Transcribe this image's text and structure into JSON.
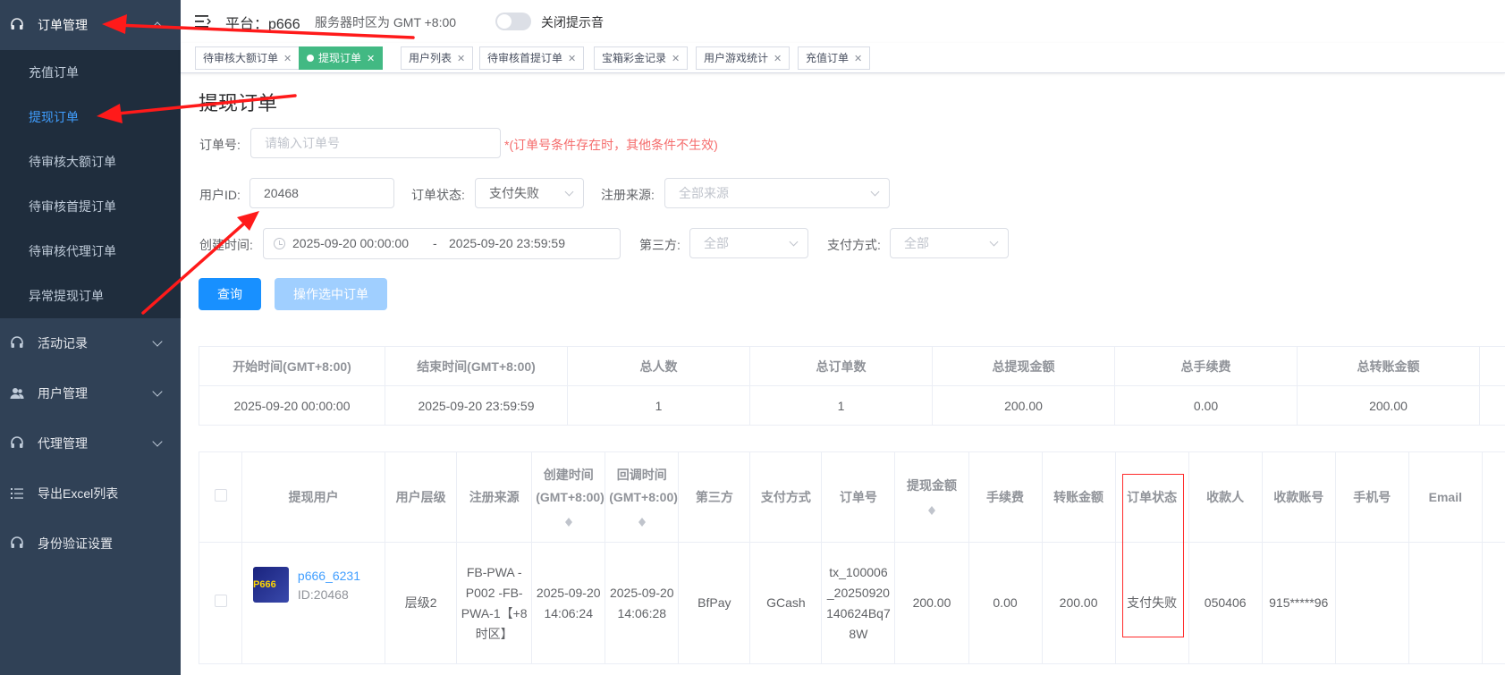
{
  "sidebar": {
    "groups": [
      {
        "label": "订单管理",
        "icon": "headset-icon",
        "expanded": true
      },
      {
        "label": "活动记录",
        "icon": "headset-icon"
      },
      {
        "label": "用户管理",
        "icon": "user-icon"
      },
      {
        "label": "代理管理",
        "icon": "headset-icon"
      },
      {
        "label": "导出Excel列表",
        "icon": "list-icon"
      },
      {
        "label": "身份验证设置",
        "icon": "headset-icon"
      }
    ],
    "order_items": [
      "充值订单",
      "提现订单",
      "待审核大额订单",
      "待审核首提订单",
      "待审核代理订单",
      "异常提现订单"
    ],
    "active_item": "提现订单"
  },
  "navbar": {
    "platform": "平台：p666",
    "timezone": "服务器时区为 GMT +8:00",
    "toggle_label": "关闭提示音",
    "toggle_on": false
  },
  "tags": [
    "待审核大额订单",
    "提现订单",
    "用户列表",
    "待审核首提订单",
    "宝箱彩金记录",
    "用户游戏统计",
    "充值订单"
  ],
  "active_tag": "提现订单",
  "page_title": "提现订单",
  "filters": {
    "order_no_label": "订单号:",
    "order_no_placeholder": "请输入订单号",
    "order_no_hint": "*(订单号条件存在时，其他条件不生效)",
    "user_id_label": "用户ID:",
    "user_id_value": "20468",
    "status_label": "订单状态:",
    "status_value": "支付失败",
    "source_label": "注册来源:",
    "source_placeholder": "全部来源",
    "created_label": "创建时间:",
    "date_start": "2025-09-20 00:00:00",
    "date_sep": "-",
    "date_end": "2025-09-20 23:59:59",
    "third_label": "第三方:",
    "third_value": "全部",
    "pay_label": "支付方式:",
    "pay_value": "全部"
  },
  "buttons": {
    "query": "查询",
    "batch": "操作选中订单"
  },
  "summary": {
    "headers": [
      "开始时间(GMT+8:00)",
      "结束时间(GMT+8:00)",
      "总人数",
      "总订单数",
      "总提现金额",
      "总手续费",
      "总转账金额"
    ],
    "values": [
      "2025-09-20 00:00:00",
      "2025-09-20 23:59:59",
      "1",
      "1",
      "200.00",
      "0.00",
      "200.00"
    ]
  },
  "table": {
    "headers": {
      "user": "提现用户",
      "level": "用户层级",
      "source": "注册来源",
      "created": "创建时间(GMT+8:00)",
      "callback": "回调时间(GMT+8:00)",
      "third": "第三方",
      "pay": "支付方式",
      "order_no": "订单号",
      "amount": "提现金额",
      "fee": "手续费",
      "transfer": "转账金额",
      "status": "订单状态",
      "payee": "收款人",
      "account": "收款账号",
      "phone": "手机号",
      "email": "Email"
    },
    "rows": [
      {
        "avatar_text": "P666",
        "username": "p666_6231",
        "uid": "ID:20468",
        "level": "层级2",
        "source": "FB-PWA - P002 -FB-PWA-1【+8时区】",
        "created": "2025-09-20 14:06:24",
        "callback": "2025-09-20 14:06:28",
        "third": "BfPay",
        "pay": "GCash",
        "order_no": "tx_100006_20250920140624Bq78W",
        "amount": "200.00",
        "fee": "0.00",
        "transfer": "200.00",
        "status": "支付失败",
        "payee": "050406",
        "account": "915*****96",
        "phone": "",
        "email": ""
      }
    ]
  },
  "colors": {
    "sidebar_bg": "#304156",
    "active_link": "#409eff",
    "active_tag": "#42b983",
    "error": "#ff0000",
    "annotation": "#ff1a1a"
  }
}
